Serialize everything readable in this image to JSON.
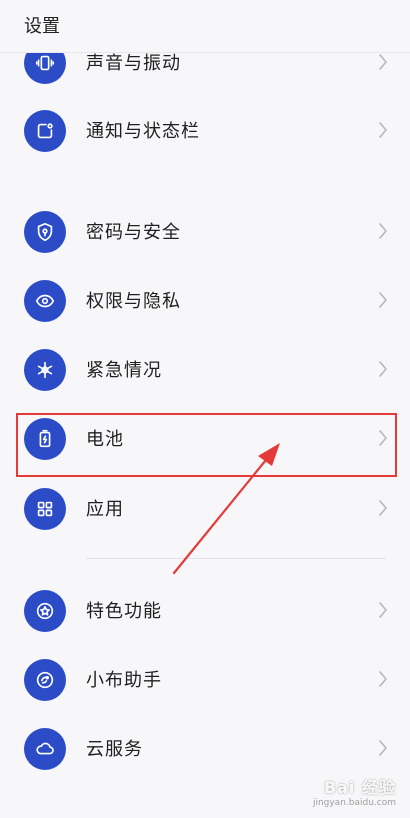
{
  "header": {
    "title": "设置"
  },
  "items": [
    {
      "label": "声音与振动",
      "icon": "vibration-icon"
    },
    {
      "label": "通知与状态栏",
      "icon": "notification-icon"
    },
    {
      "label": "密码与安全",
      "icon": "shield-icon"
    },
    {
      "label": "权限与隐私",
      "icon": "privacy-eye-icon"
    },
    {
      "label": "紧急情况",
      "icon": "emergency-icon"
    },
    {
      "label": "电池",
      "icon": "battery-icon"
    },
    {
      "label": "应用",
      "icon": "apps-grid-icon"
    },
    {
      "label": "特色功能",
      "icon": "star-icon"
    },
    {
      "label": "小布助手",
      "icon": "assistant-icon"
    },
    {
      "label": "云服务",
      "icon": "cloud-icon"
    }
  ],
  "watermark": {
    "main": "Bai 经验",
    "sub": "jingyan.baidu.com"
  },
  "colors": {
    "accent": "#2b4cc6",
    "highlight": "#e53a3a",
    "background": "#f7f7f9"
  }
}
